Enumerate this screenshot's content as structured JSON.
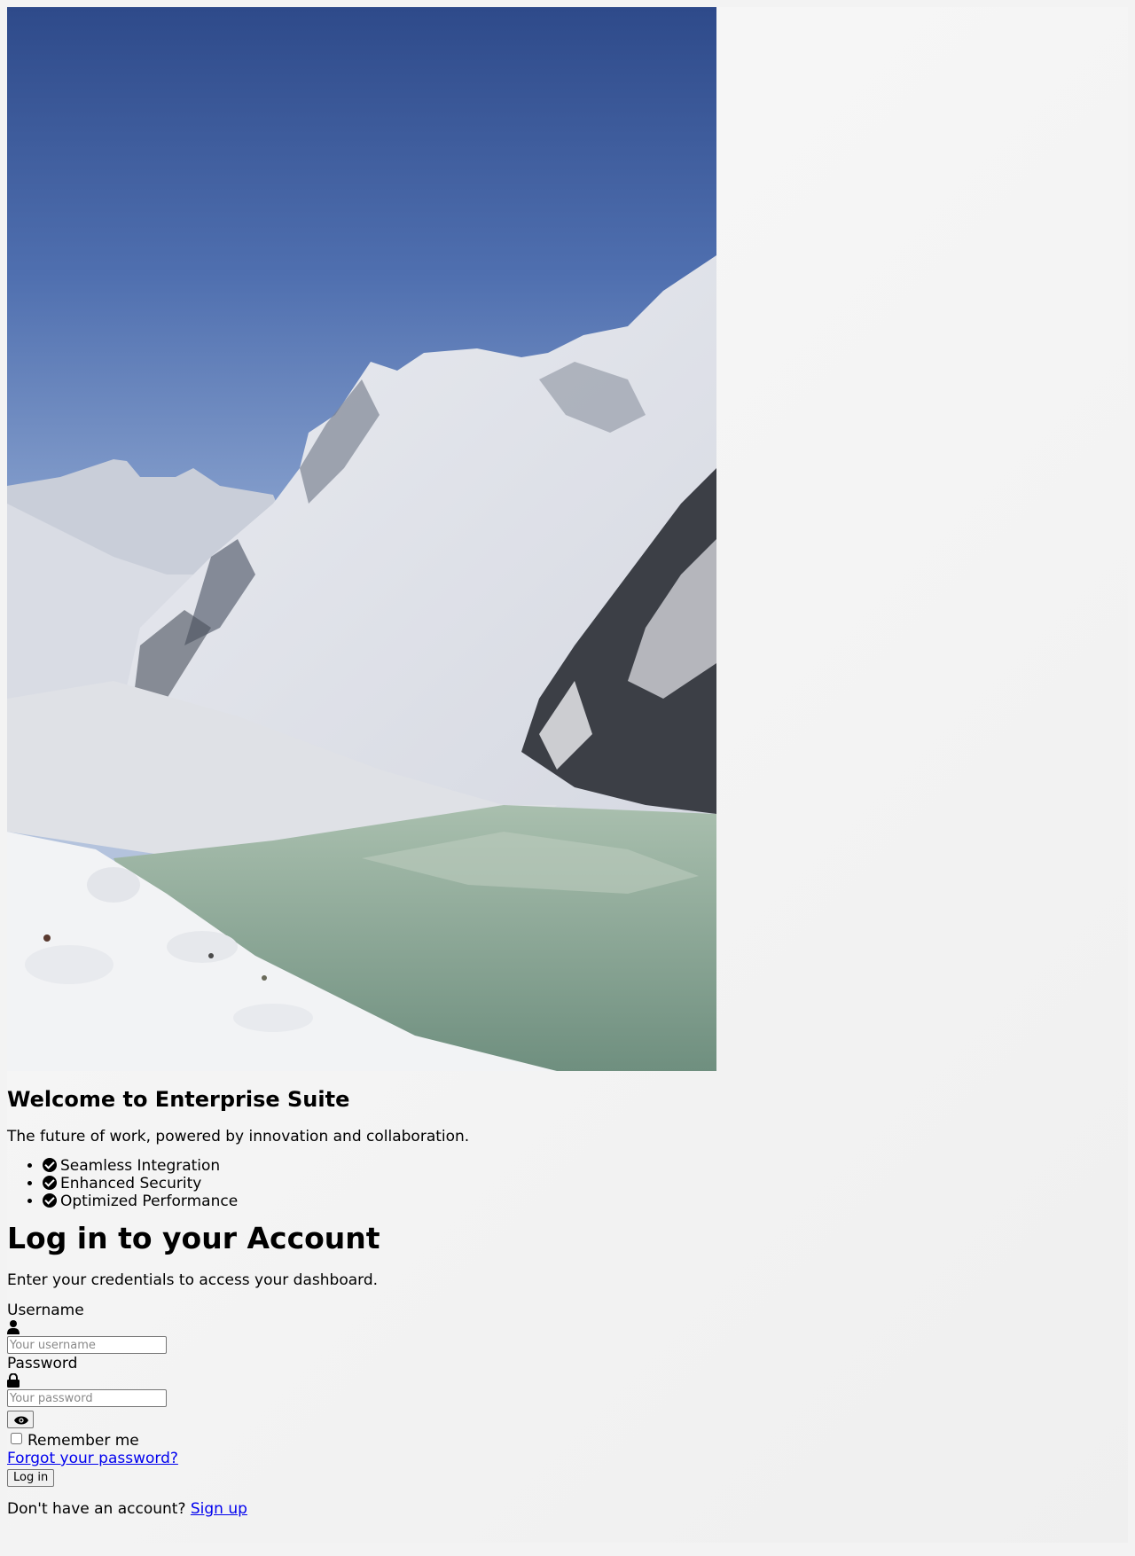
{
  "hero": {
    "image_description_icon": "mountain-lake-photo"
  },
  "welcome": {
    "title": "Welcome to Enterprise Suite",
    "tagline": "The future of work, powered by innovation and collaboration.",
    "features": [
      {
        "label": "Seamless Integration",
        "icon": "check-circle-icon"
      },
      {
        "label": "Enhanced Security",
        "icon": "check-circle-icon"
      },
      {
        "label": "Optimized Performance",
        "icon": "check-circle-icon"
      }
    ]
  },
  "login": {
    "heading": "Log in to your Account",
    "subtitle": "Enter your credentials to access your dashboard.",
    "username_label": "Username",
    "username_placeholder": "Your username",
    "password_label": "Password",
    "password_placeholder": "Your password",
    "remember_label": "Remember me",
    "forgot_link": "Forgot your password?",
    "submit_label": "Log in",
    "signup_prompt": "Don't have an account?",
    "signup_link": "Sign up"
  }
}
